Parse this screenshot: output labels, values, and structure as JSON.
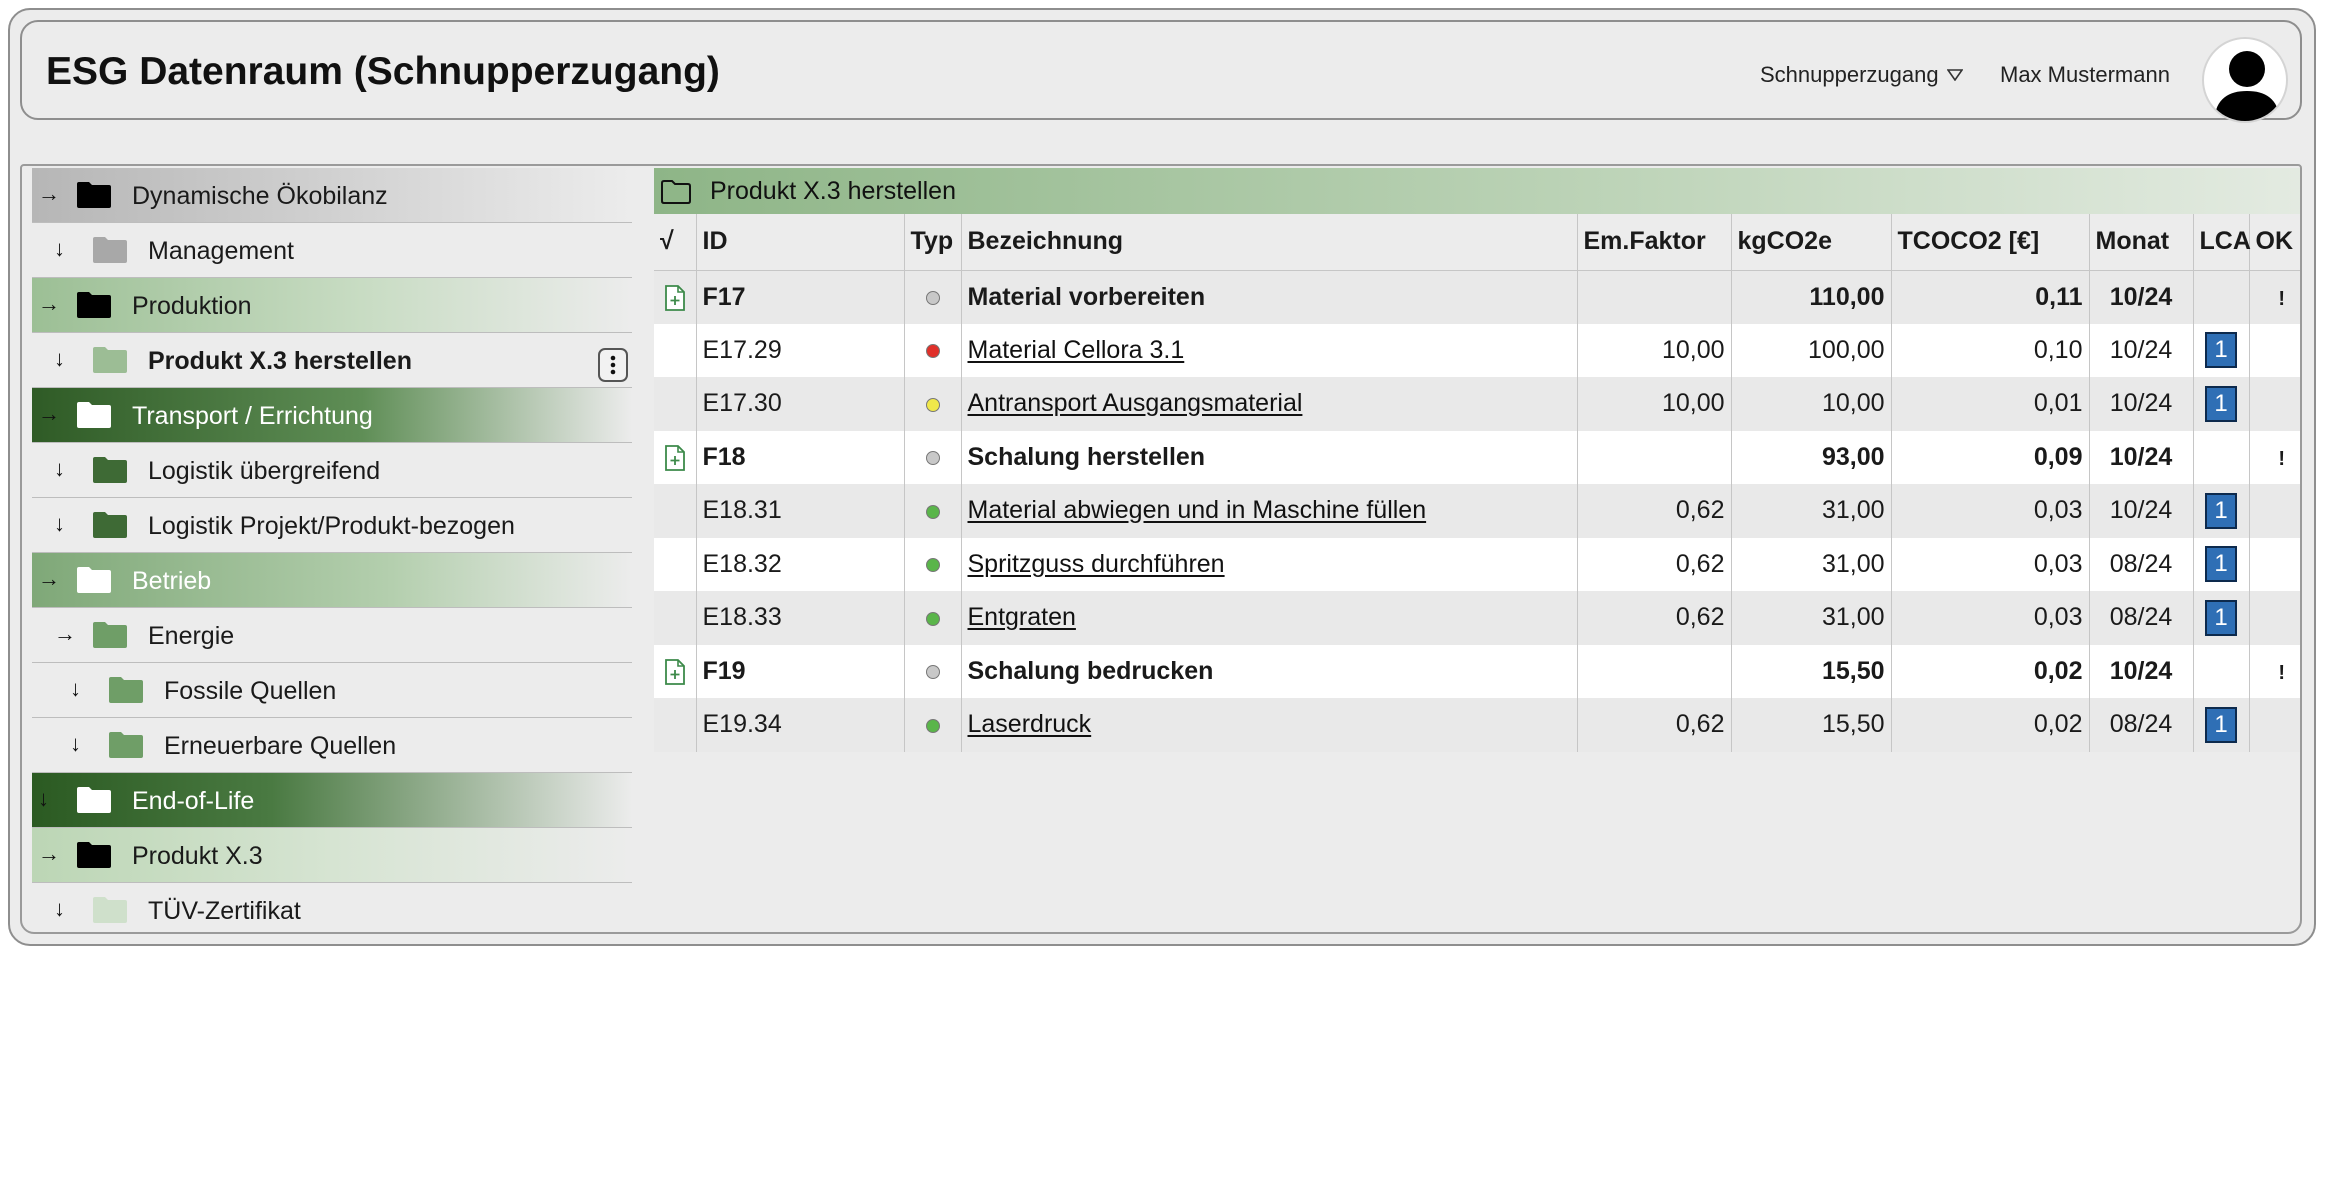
{
  "header": {
    "title": "ESG Datenraum (Schnupperzugang)",
    "access_label": "Schnupperzugang",
    "user_name": "Max Mustermann"
  },
  "sidebar": {
    "items": [
      {
        "label": "Dynamische Ökobilanz",
        "arrow": "→",
        "folder_color": "#000000"
      },
      {
        "label": "Management",
        "arrow": "↓",
        "folder_color": "#a8a8a8"
      },
      {
        "label": "Produktion",
        "arrow": "→",
        "folder_color": "#000000"
      },
      {
        "label": "Produkt X.3 herstellen",
        "arrow": "↓",
        "folder_color": "#9cbd95",
        "selected": true
      },
      {
        "label": "Transport / Errichtung",
        "arrow": "→",
        "folder_color": "#ffffff"
      },
      {
        "label": "Logistik übergreifend",
        "arrow": "↓",
        "folder_color": "#3e6a35"
      },
      {
        "label": "Logistik Projekt/Produkt-bezogen",
        "arrow": "↓",
        "folder_color": "#3e6a35"
      },
      {
        "label": "Betrieb",
        "arrow": "→",
        "folder_color": "#ffffff"
      },
      {
        "label": "Energie",
        "arrow": "→",
        "folder_color": "#6f9e67"
      },
      {
        "label": "Fossile Quellen",
        "arrow": "↓",
        "folder_color": "#6f9e67"
      },
      {
        "label": "Erneuerbare Quellen",
        "arrow": "↓",
        "folder_color": "#6f9e67"
      },
      {
        "label": "End-of-Life",
        "arrow": "↓",
        "folder_color": "#ffffff"
      },
      {
        "label": "Produkt X.3",
        "arrow": "→",
        "folder_color": "#000000"
      },
      {
        "label": "TÜV-Zertifikat",
        "arrow": "↓",
        "folder_color": "#cfe0cb"
      }
    ]
  },
  "main": {
    "breadcrumb": "Produkt X.3 herstellen",
    "columns": {
      "check": "√",
      "id": "ID",
      "typ": "Typ",
      "bezeichnung": "Bezeichnung",
      "emfaktor": "Em.Faktor",
      "kgco2e": "kgCO2e",
      "tcoco2": "TCOCO2 [€]",
      "monat": "Monat",
      "lca": "LCA",
      "ok": "OK"
    },
    "rows": [
      {
        "id": "F17",
        "group": true,
        "dot": "#c8c8c8",
        "name": "Material vorbereiten",
        "em": "",
        "kg": "110,00",
        "tc": "0,11",
        "monat": "10/24",
        "lca": "",
        "ok": "!"
      },
      {
        "id": "E17.29",
        "group": false,
        "dot": "#e0302a",
        "name": "Material Cellora 3.1",
        "em": "10,00",
        "kg": "100,00",
        "tc": "0,10",
        "monat": "10/24",
        "lca": "1",
        "ok": ""
      },
      {
        "id": "E17.30",
        "group": false,
        "dot": "#f0e84a",
        "name": "Antransport Ausgangsmaterial",
        "em": "10,00",
        "kg": "10,00",
        "tc": "0,01",
        "monat": "10/24",
        "lca": "1",
        "ok": ""
      },
      {
        "id": "F18",
        "group": true,
        "dot": "#c8c8c8",
        "name": "Schalung herstellen",
        "em": "",
        "kg": "93,00",
        "tc": "0,09",
        "monat": "10/24",
        "lca": "",
        "ok": "!"
      },
      {
        "id": "E18.31",
        "group": false,
        "dot": "#5ab54a",
        "name": "Material abwiegen und in Maschine füllen",
        "em": "0,62",
        "kg": "31,00",
        "tc": "0,03",
        "monat": "10/24",
        "lca": "1",
        "ok": ""
      },
      {
        "id": "E18.32",
        "group": false,
        "dot": "#5ab54a",
        "name": "Spritzguss durchführen",
        "em": "0,62",
        "kg": "31,00",
        "tc": "0,03",
        "monat": "08/24",
        "lca": "1",
        "ok": ""
      },
      {
        "id": "E18.33",
        "group": false,
        "dot": "#5ab54a",
        "name": "Entgraten",
        "em": "0,62",
        "kg": "31,00",
        "tc": "0,03",
        "monat": "08/24",
        "lca": "1",
        "ok": ""
      },
      {
        "id": "F19",
        "group": true,
        "dot": "#c8c8c8",
        "name": "Schalung bedrucken",
        "em": "",
        "kg": "15,50",
        "tc": "0,02",
        "monat": "10/24",
        "lca": "",
        "ok": "!"
      },
      {
        "id": "E19.34",
        "group": false,
        "dot": "#5ab54a",
        "name": "Laserdruck",
        "em": "0,62",
        "kg": "15,50",
        "tc": "0,02",
        "monat": "08/24",
        "lca": "1",
        "ok": ""
      }
    ]
  },
  "colors": {
    "accent_green": "#5f8e56",
    "lca_badge": "#2f6fb5",
    "doc_icon": "#3d8a4a"
  }
}
